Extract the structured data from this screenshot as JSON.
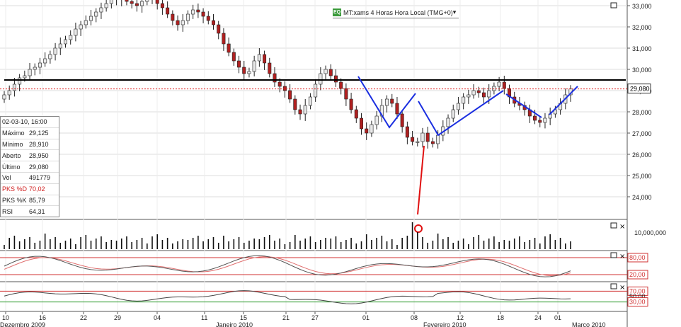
{
  "chart_data": {
    "type": "candlestick",
    "instrument_title": "MT:xams 4 Horas Hora Local (TMG+0)",
    "price_axis": {
      "ticks": [
        "33,000",
        "32,000",
        "31,000",
        "30,000",
        "29,000",
        "28,000",
        "27,000",
        "26,000",
        "25,000",
        "24,000"
      ],
      "current_price": "29,080"
    },
    "volume_axis": {
      "ticks": [
        "10,000,000"
      ]
    },
    "stoch_axis": {
      "levels": [
        "80,00",
        "20,00"
      ]
    },
    "rsi_axis": {
      "levels": [
        "70,00",
        "50,00",
        "30,00"
      ]
    },
    "x_ticks": [
      "10",
      "16",
      "22",
      "29",
      "04",
      "11",
      "15",
      "21",
      "27",
      "01",
      "08",
      "12",
      "18",
      "24",
      "01"
    ],
    "months": [
      "Dezembro 2009",
      "Janeiro 2010",
      "Fevereiro 2010",
      "Março 2010"
    ],
    "resistance_level": 29500,
    "current_level": 29080,
    "closes": [
      28800,
      29000,
      29300,
      29600,
      29700,
      30000,
      30100,
      30300,
      30500,
      30700,
      31000,
      31200,
      31400,
      31600,
      31900,
      32100,
      32300,
      32500,
      32700,
      32900,
      33100,
      33300,
      33400,
      33300,
      33200,
      33100,
      33000,
      33200,
      33400,
      33300,
      33100,
      32900,
      32600,
      32300,
      32100,
      32300,
      32600,
      32800,
      32700,
      32500,
      32300,
      32100,
      31700,
      31200,
      30800,
      30400,
      30100,
      29800,
      29900,
      30400,
      30700,
      30300,
      29800,
      29400,
      29200,
      29000,
      28600,
      28100,
      27900,
      28300,
      28700,
      29300,
      29800,
      30000,
      29700,
      29400,
      29100,
      28600,
      28100,
      27700,
      27200,
      27000,
      27400,
      27800,
      28300,
      28600,
      28400,
      27900,
      27300,
      26800,
      26600,
      26600,
      27000,
      26600,
      26500,
      26900,
      27300,
      27700,
      28100,
      28400,
      28700,
      28800,
      29000,
      28900,
      28700,
      29000,
      29200,
      29400,
      29100,
      28700,
      28400,
      28300,
      28100,
      27800,
      27600,
      27500,
      27700,
      27900,
      28100,
      28400,
      28800,
      29080
    ]
  },
  "info_panel": {
    "datetime": "02-03-10, 16:00",
    "rows": [
      {
        "label": "Máximo",
        "value": "29,125"
      },
      {
        "label": "Mínimo",
        "value": "28,910"
      },
      {
        "label": "Aberto",
        "value": "28,950"
      },
      {
        "label": "Último",
        "value": "29,080"
      },
      {
        "label": "Vol",
        "value": "491779"
      },
      {
        "label": "PKS %D",
        "value": "70,02"
      },
      {
        "label": "PKS %K",
        "value": "85,79"
      },
      {
        "label": "RSI",
        "value": "64,31"
      }
    ]
  },
  "colors": {
    "up": "#e8e8e8",
    "down": "#b02020",
    "pattern": "#1a2ee0",
    "annotation": "#e01010",
    "resistance": "#000000",
    "current": "#e02020",
    "stoch_k": "#555555",
    "stoch_d": "#e07070"
  }
}
